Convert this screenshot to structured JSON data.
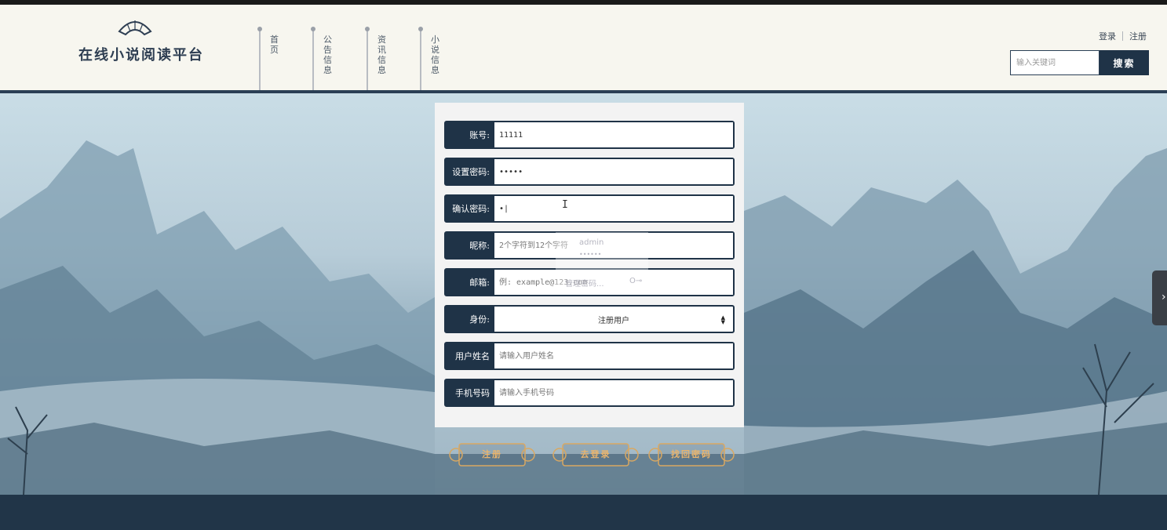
{
  "header": {
    "logo_text": "在线小说阅读平台",
    "nav": [
      {
        "label": "首页"
      },
      {
        "label": "公告信息"
      },
      {
        "label": "资讯信息"
      },
      {
        "label": "小说信息"
      }
    ],
    "login_label": "登录",
    "register_label": "注册",
    "search_placeholder": "输入关键词",
    "search_button": "搜索"
  },
  "form": {
    "fields": [
      {
        "label": "账号:",
        "value": "11111",
        "placeholder": "",
        "type": "text"
      },
      {
        "label": "设置密码:",
        "value": "•••••",
        "placeholder": "",
        "type": "text"
      },
      {
        "label": "确认密码:",
        "value": "•|",
        "placeholder": "",
        "type": "text"
      },
      {
        "label": "昵称:",
        "value": "",
        "placeholder": "2个字符到12个字符",
        "type": "text"
      },
      {
        "label": "邮箱:",
        "value": "",
        "placeholder": "例: example@123.com",
        "type": "text"
      },
      {
        "label": "身份:",
        "value": "注册用户",
        "type": "select"
      },
      {
        "label": "用户姓名",
        "value": "",
        "placeholder": "请输入用户姓名",
        "type": "text"
      },
      {
        "label": "手机号码",
        "value": "",
        "placeholder": "请输入手机号码",
        "type": "text"
      }
    ],
    "autofill": {
      "username": "admin",
      "password": "••••••",
      "manage": "管理密码..."
    }
  },
  "actions": {
    "register": "注册",
    "go_login": "去登录",
    "recover_password": "找回密码"
  },
  "colors": {
    "primary": "#1f3347",
    "header_bg": "#f7f6ef",
    "button_gold": "#e9b46d"
  }
}
